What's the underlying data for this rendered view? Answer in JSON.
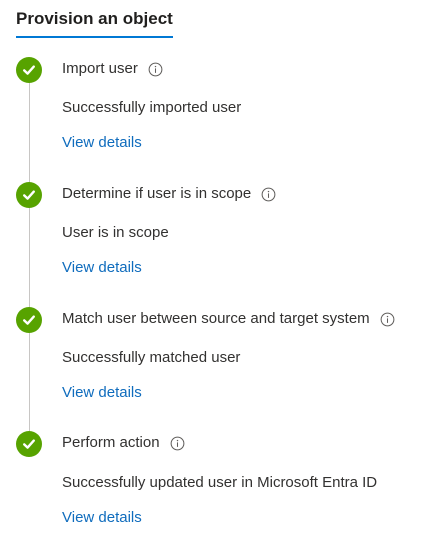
{
  "page": {
    "title": "Provision an object"
  },
  "colors": {
    "accent": "#0078d4",
    "success": "#57a300",
    "link": "#0f6cbd",
    "text": "#323130",
    "timeline": "#c8c6c4"
  },
  "steps": [
    {
      "title": "Import user",
      "status": "Successfully imported user",
      "link": "View details",
      "icon": "check-circle-icon",
      "info_icon": "info-icon"
    },
    {
      "title": "Determine if user is in scope",
      "status": "User is in scope",
      "link": "View details",
      "icon": "check-circle-icon",
      "info_icon": "info-icon"
    },
    {
      "title": "Match user between source and target system",
      "status": "Successfully matched user",
      "link": "View details",
      "icon": "check-circle-icon",
      "info_icon": "info-icon"
    },
    {
      "title": "Perform action",
      "status": "Successfully updated user in Microsoft Entra ID",
      "link": "View details",
      "icon": "check-circle-icon",
      "info_icon": "info-icon"
    }
  ]
}
